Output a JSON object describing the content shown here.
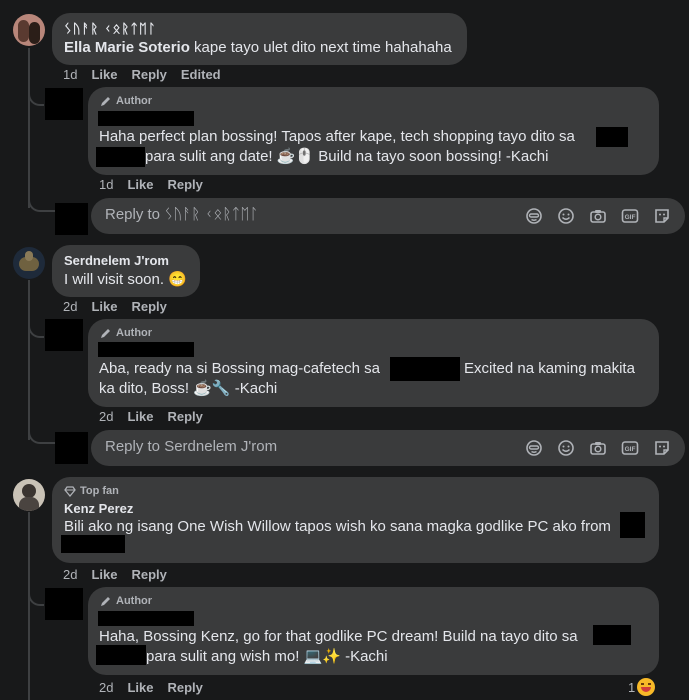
{
  "comments": [
    {
      "author": "ᛊᚢᚨᚱ ᚲᛟᚱᛏᛖᛚ",
      "author_line2": "Ella Marie Soterio",
      "text": "kape tayo ulet dito next time hahahaha",
      "time": "1d",
      "like": "Like",
      "reply": "Reply",
      "edited": "Edited",
      "author_reply": {
        "badge": "Author",
        "line1": "Haha perfect plan bossing! Tapos after kape, tech shopping tayo dito sa",
        "line2": "para sulit ang date! ☕🖱️  Build na tayo soon bossing! -Kachi",
        "time": "1d",
        "like": "Like",
        "reply": "Reply"
      },
      "reply_placeholder": "Reply to ᛊᚢᚨᚱ ᚲᛟᚱᛏᛖᛚ"
    },
    {
      "author": "Serdnelem J'rom",
      "text": "I will visit soon. 😁",
      "time": "2d",
      "like": "Like",
      "reply": "Reply",
      "author_reply": {
        "badge": "Author",
        "line1a": "Aba, ready na si Bossing mag-cafetech sa",
        "line1b": "Excited na kaming makita",
        "line2": "ka dito, Boss! ☕🔧  -Kachi",
        "time": "2d",
        "like": "Like",
        "reply": "Reply"
      },
      "reply_placeholder": "Reply to Serdnelem J'rom"
    },
    {
      "badge": "Top fan",
      "author": "Kenz Perez",
      "text": "Bili ako ng isang One Wish Willow tapos wish ko sana magka godlike PC ako from",
      "time": "2d",
      "like": "Like",
      "reply": "Reply",
      "author_reply": {
        "badge": "Author",
        "line1": "Haha, Bossing Kenz, go for that godlike PC dream! Build na tayo dito sa",
        "line2": "para sulit ang wish mo! 💻✨  -Kachi",
        "time": "2d",
        "like": "Like",
        "reply": "Reply",
        "reaction_count": "1"
      }
    }
  ],
  "icons": [
    "pencil-icon",
    "diamond-icon",
    "sticker-icon",
    "emoji-icon",
    "camera-icon",
    "gif-icon",
    "avatar-sticker-icon"
  ]
}
